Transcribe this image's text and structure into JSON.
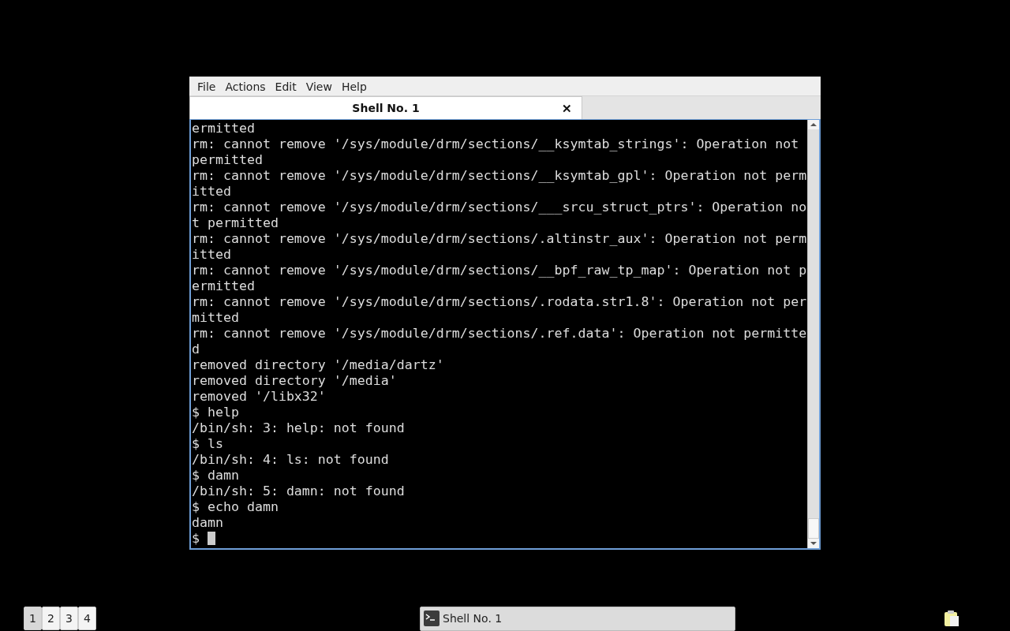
{
  "window": {
    "menu": [
      "File",
      "Actions",
      "Edit",
      "View",
      "Help"
    ],
    "tabs": [
      {
        "label": "Shell No. 1",
        "selected": true,
        "close": "✕"
      }
    ]
  },
  "terminal": {
    "lines": [
      "ermitted",
      "rm: cannot remove '/sys/module/drm/sections/__ksymtab_strings': Operation not",
      "permitted",
      "rm: cannot remove '/sys/module/drm/sections/__ksymtab_gpl': Operation not perm",
      "itted",
      "rm: cannot remove '/sys/module/drm/sections/___srcu_struct_ptrs': Operation no",
      "t permitted",
      "rm: cannot remove '/sys/module/drm/sections/.altinstr_aux': Operation not perm",
      "itted",
      "rm: cannot remove '/sys/module/drm/sections/__bpf_raw_tp_map': Operation not p",
      "ermitted",
      "rm: cannot remove '/sys/module/drm/sections/.rodata.str1.8': Operation not per",
      "mitted",
      "rm: cannot remove '/sys/module/drm/sections/.ref.data': Operation not permitte",
      "d",
      "removed directory '/media/dartz'",
      "removed directory '/media'",
      "removed '/libx32'",
      "$ help",
      "/bin/sh: 3: help: not found",
      "$ ls",
      "/bin/sh: 4: ls: not found",
      "$ damn",
      "/bin/sh: 5: damn: not found",
      "$ echo damn",
      "damn"
    ],
    "prompt": "$"
  },
  "taskbar": {
    "workspaces": [
      {
        "label": "1",
        "selected": true
      },
      {
        "label": "2",
        "selected": false
      },
      {
        "label": "3",
        "selected": false
      },
      {
        "label": "4",
        "selected": false
      }
    ],
    "tasks": [
      {
        "label": "Shell No. 1"
      }
    ]
  }
}
